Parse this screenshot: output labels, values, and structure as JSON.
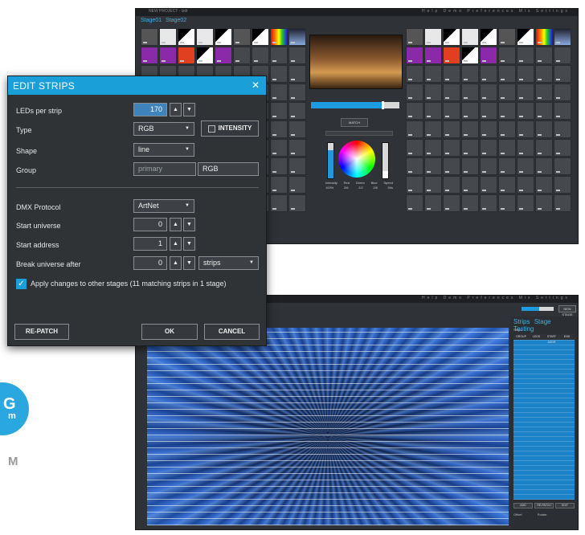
{
  "brand": {
    "circle_text": "G",
    "circle_sub": "m",
    "side_letter": "M"
  },
  "top_window": {
    "title": "NEW PROJECT - lzdr",
    "menu": "Help  Demo  Preferences  Mix  Settings",
    "tabs": [
      "Stage01",
      "Stage02"
    ],
    "match_button": "MATCH",
    "color_labels": [
      "Intensity",
      "Red",
      "Green",
      "Blue",
      "Speed"
    ],
    "color_values": [
      "100%",
      "2/6",
      "2/2",
      "2/6",
      "50s"
    ],
    "preview_progress": 0.8
  },
  "dialog": {
    "title": "EDIT STRIPS",
    "close_glyph": "✕",
    "fields": {
      "leds_per_strip": {
        "label": "LEDs per strip",
        "value": "170"
      },
      "type": {
        "label": "Type",
        "value": "RGB",
        "intensity_label": "INTENSITY"
      },
      "shape": {
        "label": "Shape",
        "value": "line"
      },
      "group": {
        "label": "Group",
        "placeholder": "primary",
        "value2": "RGB"
      },
      "dmx_protocol": {
        "label": "DMX Protocol",
        "value": "ArtNet"
      },
      "start_universe": {
        "label": "Start universe",
        "value": "0"
      },
      "start_address": {
        "label": "Start address",
        "value": "1"
      },
      "break_universe_after": {
        "label": "Break universe after",
        "value": "0",
        "unit": "strips"
      }
    },
    "apply_changes": {
      "checked": true,
      "label": "Apply changes to other stages (11 matching strips in 1 stage)"
    },
    "buttons": {
      "repatch": "RE-PATCH",
      "ok": "OK",
      "cancel": "CANCEL"
    },
    "spin_up": "▲",
    "spin_down": "▼",
    "dropdown_glyph": "▼"
  },
  "bottom_window": {
    "menu": "Help  Demo  Preferences  Mix  Settings",
    "top_button": "NEW STAGE",
    "panel_tabs": [
      "Strips",
      "Stage",
      "Testing"
    ],
    "panel_subtitle": "Strips",
    "table_headers": [
      "GROUP",
      "LEDS",
      "START ADDR",
      "END"
    ],
    "panel_buttons": [
      "ADD",
      "RE-PATCH",
      "EDIT"
    ],
    "panel_footer": [
      "Offset",
      "Rotate"
    ],
    "top_slider_progress": 0.55
  },
  "colors": {
    "accent": "#1b9fd9",
    "panel_bg": "#303336",
    "app_bg": "#2f3236"
  }
}
